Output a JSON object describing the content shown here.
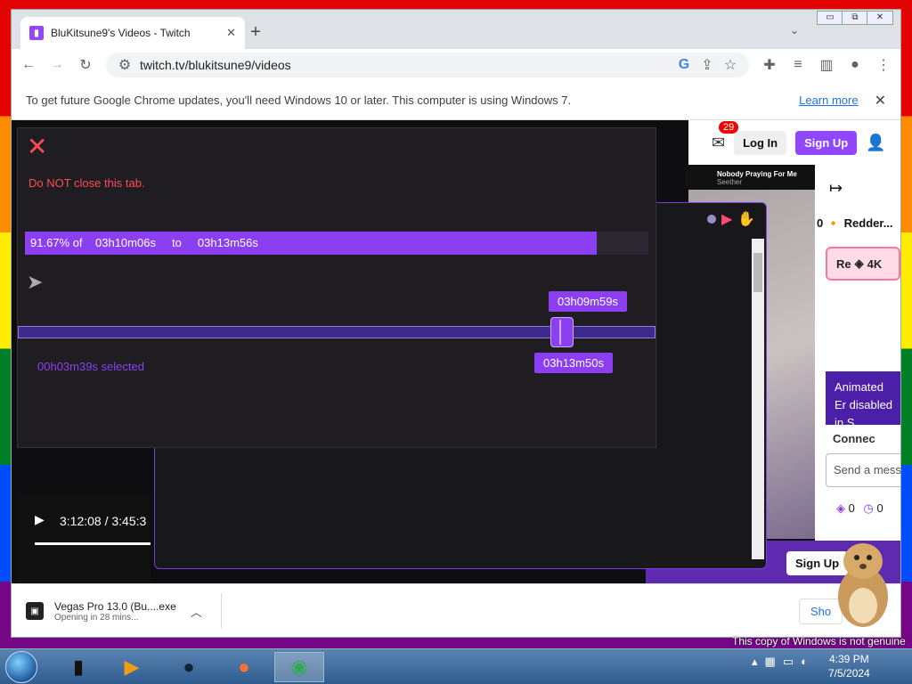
{
  "tab": {
    "title": "BluKitsune9's Videos - Twitch",
    "close": "✕"
  },
  "newtab": "+",
  "tab_menu": "⌄",
  "window": {
    "minimize": "▭",
    "restore": "⧉",
    "close": "✕"
  },
  "toolbar": {
    "back": "←",
    "forward": "→",
    "reload": "↻",
    "url": "twitch.tv/blukitsune9/videos",
    "icons": [
      "google-icon",
      "share-icon",
      "star-icon",
      "extensions-icon",
      "media-icon",
      "sidepanel-icon",
      "profile-icon",
      "menu-icon"
    ]
  },
  "infobar": {
    "text": "To get future Google Chrome updates, you'll need Windows 10 or later. This computer is using Windows 7.",
    "learn_more": "Learn more",
    "close": "✕"
  },
  "twitch": {
    "notif_count": "29",
    "login": "Log In",
    "signup": "Sign Up"
  },
  "now_playing": {
    "title": "Nobody Praying For Me",
    "artist": "Seether"
  },
  "chat": {
    "channel": "0 🔸 Redder...",
    "re_label": "Re",
    "re_count": "4K",
    "animated": "Animated Er disabled in S",
    "connect": "Connec",
    "send_placeholder": "Send a mess",
    "stats_a": "0",
    "stats_b": "0",
    "signup": "Sign Up"
  },
  "overlay": {
    "close": "✕",
    "warning": "Do NOT close this tab.",
    "progress_pct": "91.67% of",
    "progress_from": "03h10m06s",
    "progress_to_word": "to",
    "progress_to": "03h13m56s",
    "progress_fraction": 0.9167,
    "tag_start": "03h09m59s",
    "tag_end": "03h13m50s",
    "selected": "00h03m39s selected"
  },
  "player": {
    "time": "3:12:08 / 3:45:3"
  },
  "download": {
    "name": "Vegas Pro 13.0 (Bu....exe",
    "status": "Opening in 28 mins...",
    "show_all": "Sho"
  },
  "taskbar": {
    "time": "4:39 PM",
    "date": "7/5/2024",
    "apps": [
      "explorer-app",
      "media-player-app",
      "browser-app",
      "firefox-app",
      "chrome-app"
    ]
  },
  "windows_notice": "This copy of Windows is not genuine"
}
